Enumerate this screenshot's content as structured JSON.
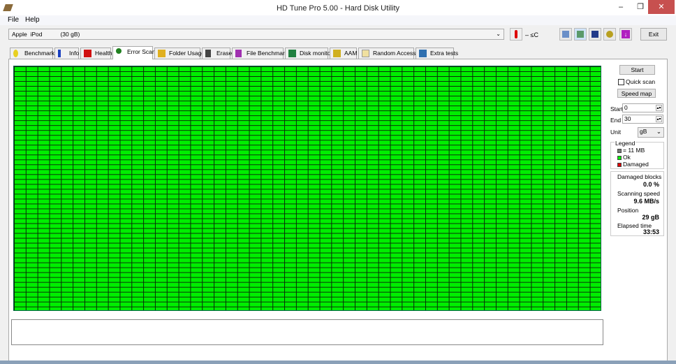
{
  "window": {
    "title": "HD Tune Pro 5.00 - Hard Disk Utility",
    "minimize": "–",
    "maximize": "❐",
    "close": "✕"
  },
  "menu": {
    "file": "File",
    "help": "Help"
  },
  "toolbar": {
    "drive": "Apple  iPod           (30 gB)",
    "temperature": "– ≤C",
    "exit": "Exit"
  },
  "tabs": [
    {
      "label": "Benchmark"
    },
    {
      "label": "Info"
    },
    {
      "label": "Health"
    },
    {
      "label": "Error Scan",
      "active": true
    },
    {
      "label": "Folder Usage"
    },
    {
      "label": "Erase"
    },
    {
      "label": "File Benchmark"
    },
    {
      "label": "Disk monitor"
    },
    {
      "label": "AAM"
    },
    {
      "label": "Random Access"
    },
    {
      "label": "Extra tests"
    }
  ],
  "scan_map": {
    "columns": 50,
    "rows": 50,
    "ok_color": "#00ee00",
    "damaged_color": "#dd0000",
    "damaged_count": 0
  },
  "controls": {
    "start_button": "Start",
    "quick_scan": "Quick scan",
    "quick_scan_checked": false,
    "speed_map": "Speed map",
    "start_label": "Start",
    "start_value": "0",
    "end_label": "End",
    "end_value": "30",
    "unit_label": "Unit",
    "unit_value": "gB"
  },
  "legend": {
    "title": "Legend",
    "block": "= 11 MB",
    "ok": "Ok",
    "damaged": "Damaged"
  },
  "stats": {
    "damaged_label": "Damaged blocks",
    "damaged_value": "0.0 %",
    "speed_label": "Scanning speed",
    "speed_value": "9.6 MB/s",
    "position_label": "Position",
    "position_value": "29 gB",
    "elapsed_label": "Elapsed time",
    "elapsed_value": "33:53"
  }
}
